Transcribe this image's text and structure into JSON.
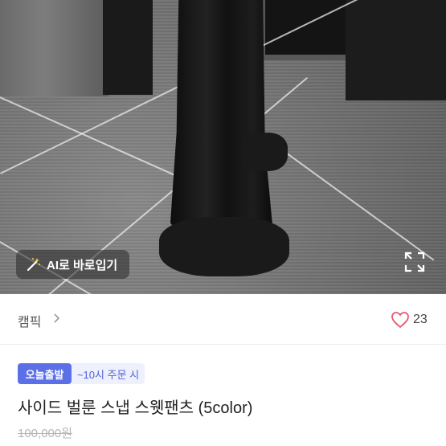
{
  "photo": {
    "ai_button_label": "AI로 바로입기",
    "ai_icon": "magic-wand-icon",
    "expand_icon": "expand-icon"
  },
  "shop": {
    "name": "캠픽",
    "chevron_icon": "chevron-right-icon",
    "like_icon": "heart-icon",
    "like_count": "23",
    "like_color": "#e8566c"
  },
  "product": {
    "badge_today": "오늘출발",
    "badge_time": "~10시 주문 시",
    "badge_color": "#5b6fe6",
    "title": "사이드 벌룬 스냅 스웻팬츠 (5color)",
    "original_price": "100,000원"
  }
}
